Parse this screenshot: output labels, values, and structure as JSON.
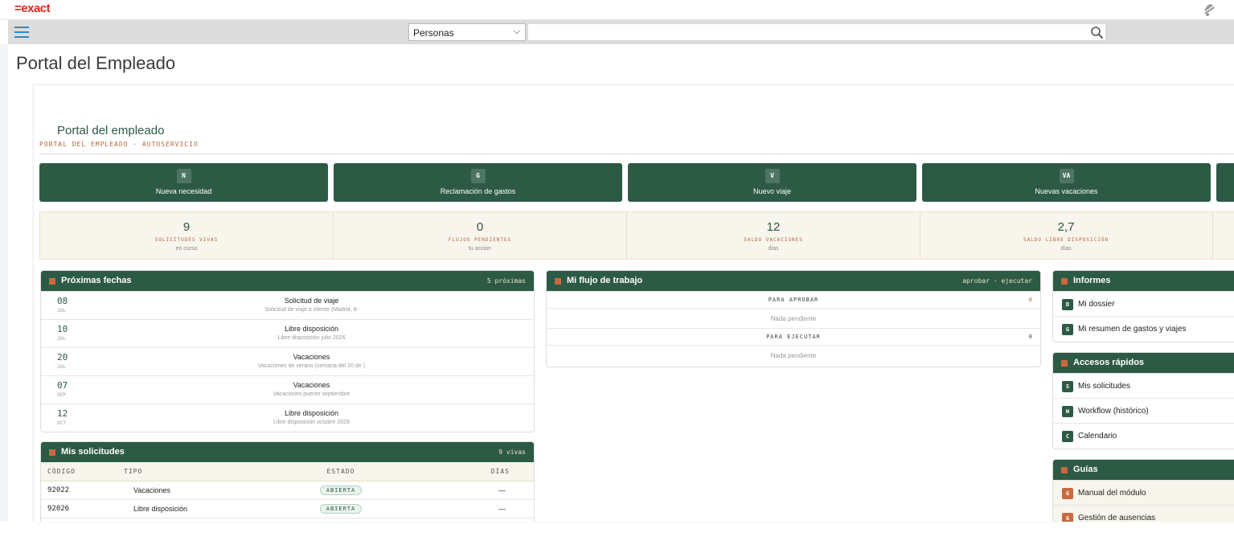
{
  "app": {
    "logo": "=exact"
  },
  "search": {
    "scope": "Personas",
    "placeholder": ""
  },
  "page": {
    "title": "Portal del Empleado"
  },
  "portal": {
    "heading": "Portal del empleado",
    "subheading": "PORTAL DEL EMPLEADO · AUTOSERVICIO"
  },
  "actions": [
    {
      "badge": "N",
      "label": "Nueva necesidad"
    },
    {
      "badge": "G",
      "label": "Reclamación de gastos"
    },
    {
      "badge": "V",
      "label": "Nuevo viaje"
    },
    {
      "badge": "VA",
      "label": "Nuevas vacaciones"
    }
  ],
  "stats": [
    {
      "value": "9",
      "label": "SOLICITUDES VIVAS",
      "sub": "en curso"
    },
    {
      "value": "0",
      "label": "FLUJOS PENDIENTES",
      "sub": "tu accion"
    },
    {
      "value": "12",
      "label": "SALDO VACACIONES",
      "sub": "días"
    },
    {
      "value": "2,7",
      "label": "SALDO LIBRE DISPOSICIÓN",
      "sub": "días"
    }
  ],
  "upcoming": {
    "title": "Próximas fechas",
    "meta": "5 próximas",
    "items": [
      {
        "day": "08",
        "month": "JUL",
        "title": "Solicitud de viaje",
        "sub": "Solicitud de viaje a cliente (Madrid, 8-"
      },
      {
        "day": "10",
        "month": "JUL",
        "title": "Libre disposición",
        "sub": "Libre disposición julio 2026"
      },
      {
        "day": "20",
        "month": "JUL",
        "title": "Vacaciones",
        "sub": "Vacaciones de verano (semana del 20 de )"
      },
      {
        "day": "07",
        "month": "SEP",
        "title": "Vacaciones",
        "sub": "Vacaciones puente septiembre"
      },
      {
        "day": "12",
        "month": "OCT",
        "title": "Libre disposición",
        "sub": "Libre disposición octubre 2026"
      }
    ]
  },
  "workflow": {
    "title": "Mi flujo de trabajo",
    "meta": "aprobar · ejecutar",
    "approve": {
      "label": "PARA APROBAR",
      "count": "0",
      "empty": "Nada pendiente"
    },
    "execute": {
      "label": "PARA EJECUTAR",
      "count": "0",
      "empty": "Nada pendiente"
    }
  },
  "requests": {
    "title": "Mis solicitudes",
    "meta": "9 vivas",
    "columns": [
      "CÓDIGO",
      "TIPO",
      "ESTADO",
      "DÍAS"
    ],
    "rows": [
      {
        "code": "92022",
        "type": "Vacaciones",
        "status": "ABIERTA",
        "days": "—"
      },
      {
        "code": "92026",
        "type": "Libre disposición",
        "status": "ABIERTA",
        "days": "—"
      }
    ]
  },
  "reports": {
    "title": "Informes",
    "items": [
      {
        "badge": "D",
        "label": "Mi dossier"
      },
      {
        "badge": "G",
        "label": "Mi resumen de gastos y viajes"
      }
    ]
  },
  "quick": {
    "title": "Accesos rápidos",
    "items": [
      {
        "badge": "S",
        "label": "Mis solicitudes"
      },
      {
        "badge": "W",
        "label": "Workflow (histórico)"
      },
      {
        "badge": "C",
        "label": "Calendario"
      }
    ]
  },
  "guides": {
    "title": "Guías",
    "items": [
      {
        "badge": "G",
        "label": "Manual del módulo"
      },
      {
        "badge": "G",
        "label": "Gestión de ausencias"
      }
    ]
  },
  "colors": {
    "brand_green": "#2d5a45",
    "accent_orange": "#c8693d",
    "logo_red": "#e1251b",
    "stat_bg": "#f7f5ec"
  }
}
